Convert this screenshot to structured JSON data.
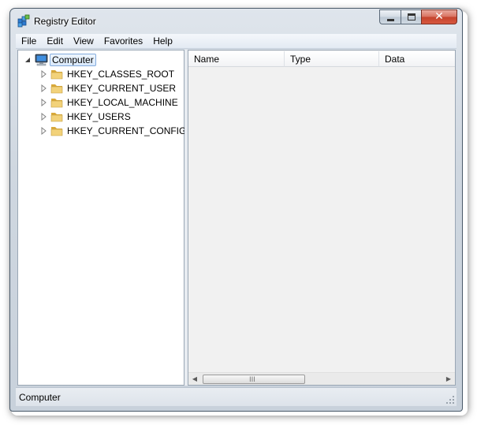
{
  "window": {
    "title": "Registry Editor",
    "close_glyph": "✕"
  },
  "menu": [
    "File",
    "Edit",
    "View",
    "Favorites",
    "Help"
  ],
  "tree": {
    "root": {
      "label": "Computer",
      "expanded": true,
      "selected": true,
      "icon": "computer-icon"
    },
    "children": [
      {
        "label": "HKEY_CLASSES_ROOT",
        "icon": "folder-icon"
      },
      {
        "label": "HKEY_CURRENT_USER",
        "icon": "folder-icon"
      },
      {
        "label": "HKEY_LOCAL_MACHINE",
        "icon": "folder-icon"
      },
      {
        "label": "HKEY_USERS",
        "icon": "folder-icon"
      },
      {
        "label": "HKEY_CURRENT_CONFIG",
        "icon": "folder-icon"
      }
    ]
  },
  "list": {
    "columns": [
      "Name",
      "Type",
      "Data"
    ],
    "scrollbar_grip": "III",
    "left_arrow": "◀",
    "right_arrow": "▶"
  },
  "status": {
    "text": "Computer"
  },
  "colors": {
    "selection_border": "#84acdd",
    "folder": "#e8c45a",
    "close_button": "#c4432c"
  }
}
